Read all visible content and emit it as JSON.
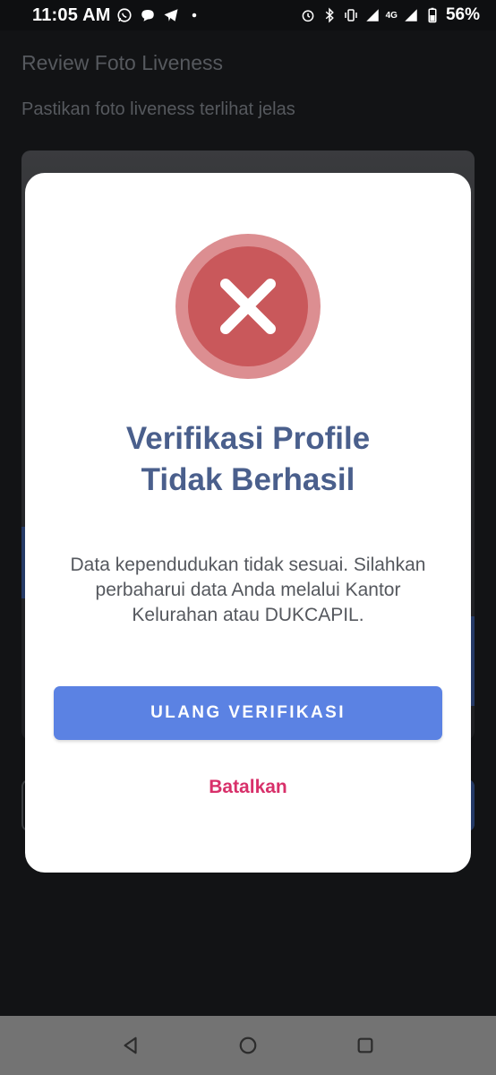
{
  "status_bar": {
    "time": "11:05 AM",
    "network_label": "4G",
    "battery_percent": "56%",
    "left_icons": [
      "whatsapp-icon",
      "chat-bubble-icon",
      "telegram-icon",
      "dot-icon"
    ],
    "right_icons": [
      "alarm-icon",
      "bluetooth-icon",
      "vibrate-icon",
      "signal-icon",
      "signal-icon",
      "battery-icon"
    ]
  },
  "page": {
    "title": "Review Foto Liveness",
    "subtitle": "Pastikan foto liveness terlihat jelas"
  },
  "modal": {
    "icon": "error-x-icon",
    "title_line1": "Verifikasi Profile",
    "title_line2": "Tidak Berhasil",
    "message": "Data kependudukan tidak sesuai. Silahkan perbaharui data Anda melalui Kantor Kelurahan atau DUKCAPIL.",
    "primary_button": "ULANG VERIFIKASI",
    "cancel_link": "Batalkan"
  },
  "nav_bar": {
    "buttons": [
      "back-icon",
      "home-icon",
      "recents-icon"
    ]
  },
  "colors": {
    "accent_blue": "#5b82e3",
    "title_blue": "#4a5f8c",
    "error_red": "#c9585b",
    "cancel_pink": "#d8306a"
  }
}
